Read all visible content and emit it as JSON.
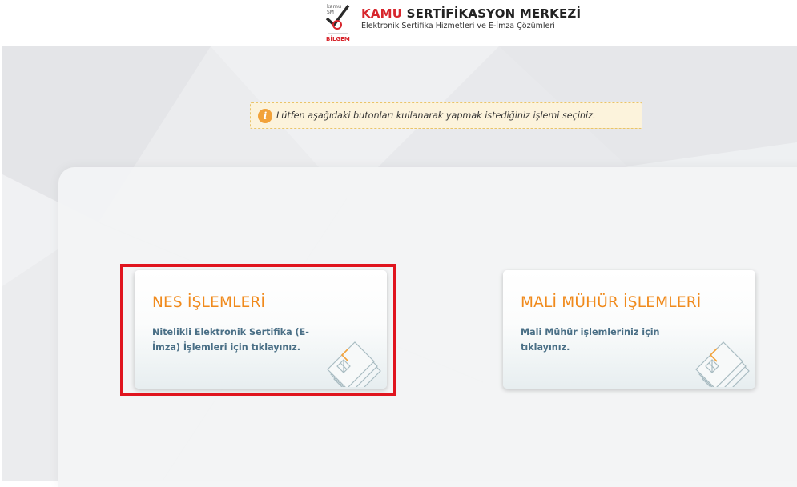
{
  "header": {
    "logo_text_top": "kamu",
    "logo_text_mid": "SM",
    "logo_text_bottom": "BİLGEM",
    "brand_red": "KAMU",
    "brand_dark": " SERTİFİKASYON MERKEZİ",
    "brand_subtitle": "Elektronik Sertifika Hizmetleri ve E-İmza Çözümleri"
  },
  "notice": {
    "icon": "info-icon",
    "text": "Lütfen aşağıdaki butonları kullanarak yapmak istediğiniz işlemi seçiniz."
  },
  "cards": [
    {
      "title": "NES İŞLEMLERİ",
      "description": "Nitelikli Elektronik Sertifika (E-İmza) İşlemleri için tıklayınız.",
      "icon": "smart-card-icon",
      "highlighted": true
    },
    {
      "title": "MALİ MÜHÜR İŞLEMLERİ",
      "description": "Mali Mühür işlemleriniz için tıklayınız.",
      "icon": "smart-card-icon",
      "highlighted": false
    }
  ],
  "colors": {
    "brand_red": "#d7262d",
    "card_title": "#f08a1c",
    "card_desc": "#4a6f86",
    "highlight_border": "#e0141e",
    "notice_bg": "#fcf3dc"
  }
}
